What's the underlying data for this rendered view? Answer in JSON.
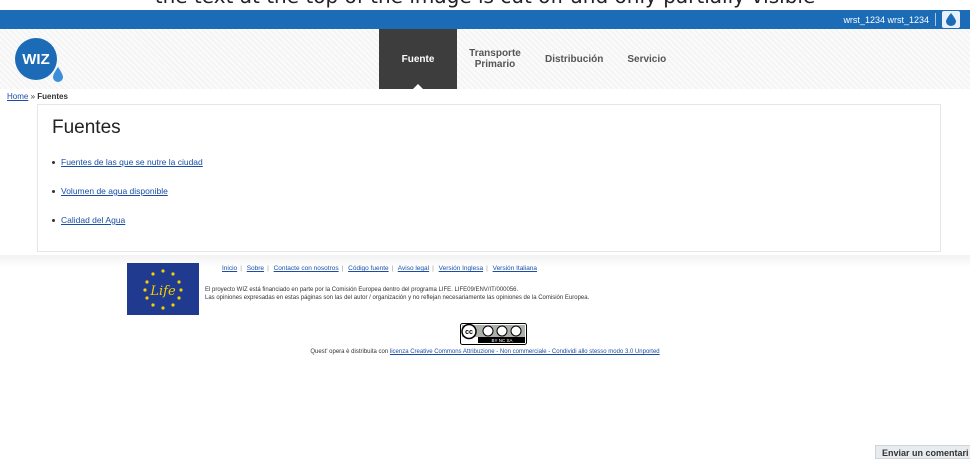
{
  "caption": "the text at the top of the image is cut off and only partially visible",
  "topbar": {
    "user_label": "wrst_1234 wrst_1234"
  },
  "header": {
    "logo_text": "WIZ",
    "nav": [
      {
        "label": "Fuente",
        "active": true
      },
      {
        "label": "Transporte Primario",
        "active": false
      },
      {
        "label": "Distribución",
        "active": false
      },
      {
        "label": "Servicio",
        "active": false
      }
    ]
  },
  "breadcrumb": {
    "home": "Home",
    "sep": "»",
    "current": "Fuentes"
  },
  "main": {
    "title": "Fuentes",
    "links": [
      "Fuentes de las que se nutre la ciudad",
      "Volumen de agua disponible",
      "Calidad del Agua"
    ]
  },
  "footer": {
    "links": [
      "Inicio",
      "Sobre",
      "Contacte con nosotros",
      "Código fuente",
      "Aviso legal",
      "Versión Inglesa",
      "Versión Italiana"
    ],
    "funding_line1": "El proyecto WIZ está financiado en parte por la Comisión Europea dentro del programa LIFE. LIFE09/ENV/IT/000056.",
    "funding_line2": "Las opiniones expresadas en estas páginas son las del autor / organización y no reflejan necesariamente las opiniones de la Comisión Europea.",
    "cc_text": "BY NC SA",
    "license_prefix": "Quest' opera è distribuita con",
    "license_link": "licenza Creative Commons Attribuzione - Non commerciale - Condividi allo stesso modo 3.0 Unported",
    "eu_flag_text": "Life"
  },
  "comment_button": "Enviar un comentari",
  "colors": {
    "topbar": "#1b6bb7",
    "nav_active": "#3d3d3d",
    "link": "#1a4ea6"
  }
}
